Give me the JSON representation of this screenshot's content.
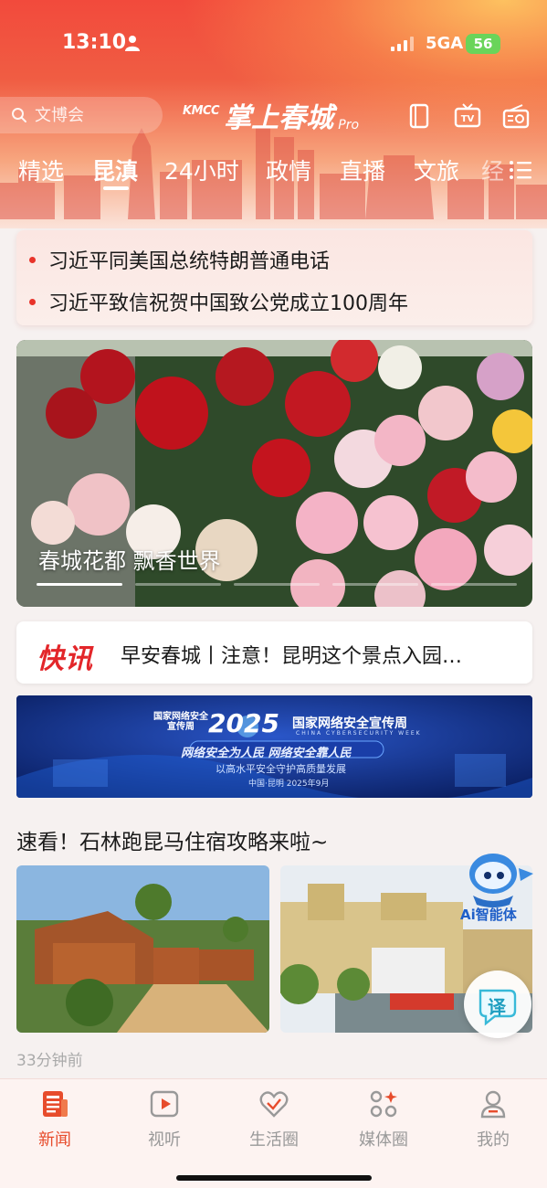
{
  "status_bar": {
    "time": "13:10",
    "network": "5GA",
    "battery": "56"
  },
  "search": {
    "placeholder": "文博会"
  },
  "app_logo": {
    "brand": "KMCC",
    "name": "掌上春城",
    "suffix": "Pro"
  },
  "header_icons": [
    "tablet-icon",
    "tv-icon",
    "radio-icon"
  ],
  "tabs": [
    {
      "label": "精选",
      "active": false
    },
    {
      "label": "昆滇",
      "active": true
    },
    {
      "label": "24小时",
      "active": false
    },
    {
      "label": "政情",
      "active": false
    },
    {
      "label": "直播",
      "active": false
    },
    {
      "label": "文旅",
      "active": false
    },
    {
      "label": "经",
      "active": false
    }
  ],
  "headlines": [
    "习近平同美国总统特朗普通电话",
    "习近平致信祝贺中国致公党成立100周年"
  ],
  "banner": {
    "caption": "春城花都 飘香世界",
    "slide_count": 5,
    "active_slide": 1
  },
  "flash_news": {
    "logo": "快讯",
    "text": "早安春城丨注意！昆明这个景点入园…"
  },
  "cyber_banner": {
    "badge_line1": "国家网络安全",
    "badge_line2": "宣传周",
    "year": "2025",
    "title": "国家网络安全宣传周",
    "subtitle": "CHINA CYBERSECURITY WEEK",
    "slogan": "网络安全为人民 网络安全靠人民",
    "line": "以高水平安全守护高质量发展",
    "date": "中国·昆明 2025年9月"
  },
  "article": {
    "title": "速看！石林跑昆马住宿攻略来啦~",
    "time": "33分钟前"
  },
  "ai_badge": {
    "label": "Ai智能体"
  },
  "translate": {
    "label": "译"
  },
  "tabbar": [
    {
      "label": "新闻",
      "icon": "news-icon",
      "active": true
    },
    {
      "label": "视听",
      "icon": "play-icon",
      "active": false
    },
    {
      "label": "生活圈",
      "icon": "heart-icon",
      "active": false
    },
    {
      "label": "媒体圈",
      "icon": "grid-icon",
      "active": false
    },
    {
      "label": "我的",
      "icon": "user-icon",
      "active": false
    }
  ],
  "colors": {
    "accent": "#e74c2c",
    "header_top": "#f24a3c",
    "flash_red": "#e3262a"
  }
}
